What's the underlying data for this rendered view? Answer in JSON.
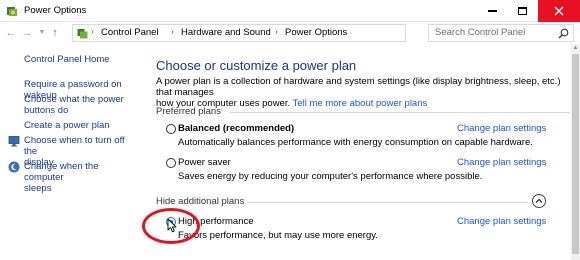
{
  "window": {
    "title": "Power Options",
    "app_icon": "power-options-icon",
    "accent_close": "#e81123"
  },
  "address_bar": {
    "breadcrumbs": [
      "Control Panel",
      "Hardware and Sound",
      "Power Options"
    ],
    "search_placeholder": "Search Control Panel"
  },
  "sidebar": {
    "home": "Control Panel Home",
    "links": [
      {
        "label_lines": [
          "Require a password on wakeup"
        ],
        "icon": null
      },
      {
        "label_lines": [
          "Choose what the power",
          "buttons do"
        ],
        "icon": null
      },
      {
        "label_lines": [
          "Create a power plan"
        ],
        "icon": null
      },
      {
        "label_lines": [
          "Choose when to turn off the",
          "display"
        ],
        "icon": "display-icon"
      },
      {
        "label_lines": [
          "Change when the computer",
          "sleeps"
        ],
        "icon": "sleep-moon-icon"
      }
    ]
  },
  "main": {
    "heading": "Choose or customize a power plan",
    "intro_line1": "A power plan is a collection of hardware and system settings (like display brightness, sleep, etc.) that manages",
    "intro_line2": "how your computer uses power. ",
    "intro_link": "Tell me more about power plans",
    "preferred_label": "Preferred plans",
    "hidden_label": "Hide additional plans",
    "change_link": "Change plan settings",
    "plans": [
      {
        "name": "Balanced (recommended)",
        "bold": true,
        "checked": false,
        "description": "Automatically balances performance with energy consumption on capable hardware."
      },
      {
        "name": "Power saver",
        "bold": false,
        "checked": false,
        "description": "Saves energy by reducing your computer's performance where possible."
      },
      {
        "name": "High performance",
        "bold": false,
        "checked": true,
        "description": "Favors performance, but may use more energy."
      }
    ]
  },
  "colors": {
    "heading": "#1e3287",
    "link": "#1a56db",
    "highlight": "#e0141e",
    "radio_selected": "#0078d7"
  }
}
